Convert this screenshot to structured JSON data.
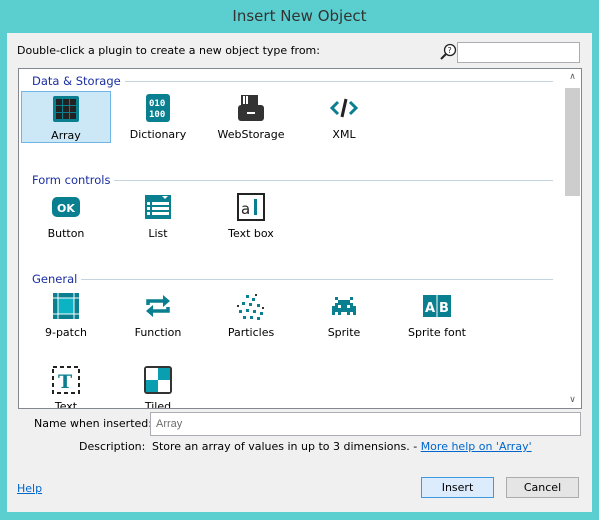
{
  "window": {
    "title": "Insert New Object"
  },
  "prompt": "Double-click a plugin to create a new object type from:",
  "search": {
    "value": "",
    "icon": "search-help-icon"
  },
  "sections": [
    {
      "title": "Data & Storage",
      "items": [
        {
          "label": "Array",
          "icon": "grid-icon",
          "selected": true
        },
        {
          "label": "Dictionary",
          "icon": "binary-icon"
        },
        {
          "label": "WebStorage",
          "icon": "storage-card-icon"
        },
        {
          "label": "XML",
          "icon": "code-tag-icon"
        }
      ]
    },
    {
      "title": "Form controls",
      "items": [
        {
          "label": "Button",
          "icon": "ok-button-icon"
        },
        {
          "label": "List",
          "icon": "list-icon"
        },
        {
          "label": "Text box",
          "icon": "text-box-icon"
        }
      ]
    },
    {
      "title": "General",
      "items": [
        {
          "label": "9-patch",
          "icon": "nine-patch-icon"
        },
        {
          "label": "Function",
          "icon": "refresh-arrows-icon"
        },
        {
          "label": "Particles",
          "icon": "particles-icon"
        },
        {
          "label": "Sprite",
          "icon": "space-invader-icon"
        },
        {
          "label": "Sprite font",
          "icon": "ab-font-icon"
        },
        {
          "label": "Text",
          "icon": "text-t-icon"
        },
        {
          "label": "Tiled Background",
          "icon": "checker-icon"
        }
      ]
    }
  ],
  "form": {
    "name_label": "Name when inserted:",
    "name_value": "Array",
    "desc_label": "Description:",
    "desc_text": "Store an array of values in up to 3 dimensions. - ",
    "desc_link": "More help on 'Array'"
  },
  "footer": {
    "help": "Help",
    "insert": "Insert",
    "cancel": "Cancel"
  },
  "colors": {
    "frame": "#5bcfcf",
    "accent": "#0a7f8f",
    "section": "#1a2fa0",
    "link": "#0066cc"
  }
}
